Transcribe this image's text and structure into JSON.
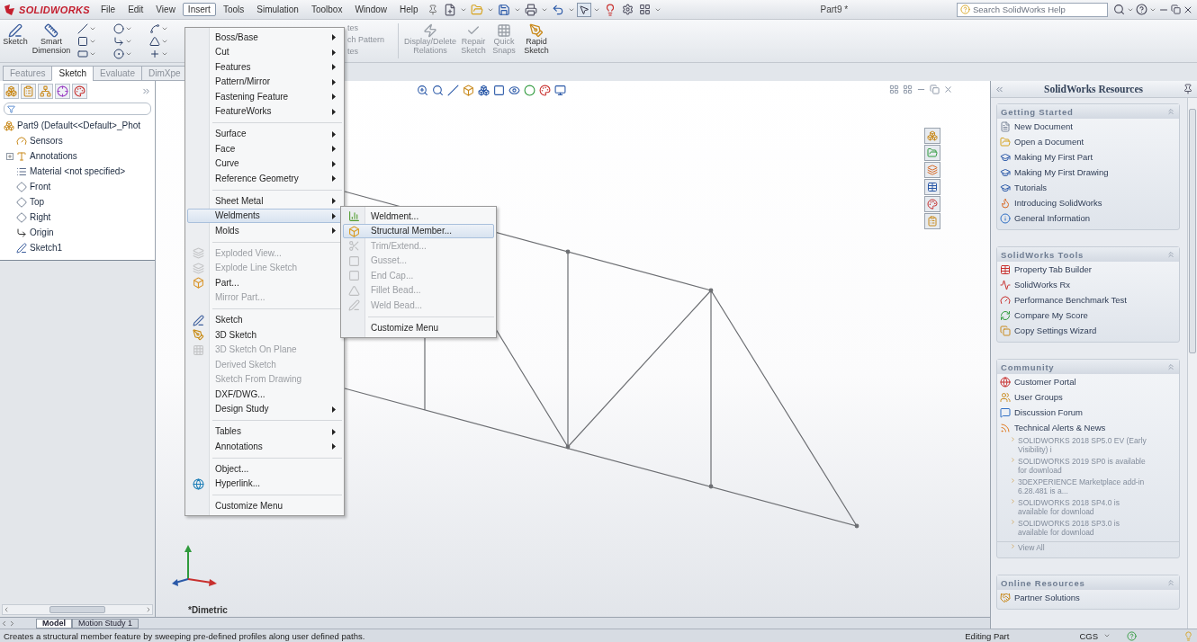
{
  "app": {
    "logo": "SOLIDWORKS",
    "document_title": "Part9 *"
  },
  "menu_bar": [
    {
      "label": "File",
      "selected": false
    },
    {
      "label": "Edit",
      "selected": false
    },
    {
      "label": "View",
      "selected": false
    },
    {
      "label": "Insert",
      "selected": true
    },
    {
      "label": "Tools",
      "selected": false
    },
    {
      "label": "Simulation",
      "selected": false
    },
    {
      "label": "Toolbox",
      "selected": false
    },
    {
      "label": "Window",
      "selected": false
    },
    {
      "label": "Help",
      "selected": false
    }
  ],
  "help_search": {
    "placeholder": "Search SolidWorks Help"
  },
  "ribbon": {
    "left": [
      {
        "label": "Sketch",
        "disabled": false
      },
      {
        "label": "Smart Dimension",
        "disabled": false
      }
    ],
    "partial_labels": [
      "tes",
      "ch Pattern",
      "tes"
    ],
    "right": [
      {
        "label": "Display/Delete Relations",
        "disabled": true
      },
      {
        "label": "Repair Sketch",
        "disabled": true
      },
      {
        "label": "Quick Snaps",
        "disabled": true
      },
      {
        "label": "Rapid Sketch",
        "disabled": false
      }
    ]
  },
  "command_tabs": [
    {
      "label": "Features",
      "selected": false
    },
    {
      "label": "Sketch",
      "selected": true
    },
    {
      "label": "Evaluate",
      "selected": false
    },
    {
      "label": "DimXpe",
      "selected": false
    }
  ],
  "feature_tree": {
    "label": "Part9  (Default<<Default>_Phot",
    "children": [
      {
        "label": "Sensors"
      },
      {
        "label": "Annotations",
        "expanded": false
      },
      {
        "label": "Material <not specified>"
      },
      {
        "label": "Front"
      },
      {
        "label": "Top"
      },
      {
        "label": "Right"
      },
      {
        "label": "Origin"
      },
      {
        "label": "Sketch1"
      }
    ]
  },
  "insert_menu": [
    {
      "kind": "item",
      "label": "Boss/Base",
      "submenu": true,
      "disabled": false,
      "selected": false
    },
    {
      "kind": "item",
      "label": "Cut",
      "submenu": true,
      "disabled": false,
      "selected": false
    },
    {
      "kind": "item",
      "label": "Features",
      "submenu": true,
      "disabled": false,
      "selected": false
    },
    {
      "kind": "item",
      "label": "Pattern/Mirror",
      "submenu": true,
      "disabled": false,
      "selected": false
    },
    {
      "kind": "item",
      "label": "Fastening Feature",
      "submenu": true,
      "disabled": false,
      "selected": false
    },
    {
      "kind": "item",
      "label": "FeatureWorks",
      "submenu": true,
      "disabled": false,
      "selected": false
    },
    {
      "kind": "separator"
    },
    {
      "kind": "item",
      "label": "Surface",
      "submenu": true,
      "disabled": false,
      "selected": false
    },
    {
      "kind": "item",
      "label": "Face",
      "submenu": true,
      "disabled": false,
      "selected": false
    },
    {
      "kind": "item",
      "label": "Curve",
      "submenu": true,
      "disabled": false,
      "selected": false
    },
    {
      "kind": "item",
      "label": "Reference Geometry",
      "submenu": true,
      "disabled": false,
      "selected": false
    },
    {
      "kind": "separator"
    },
    {
      "kind": "item",
      "label": "Sheet Metal",
      "submenu": true,
      "disabled": false,
      "selected": false
    },
    {
      "kind": "item",
      "label": "Weldments",
      "submenu": true,
      "disabled": false,
      "selected": true
    },
    {
      "kind": "item",
      "label": "Molds",
      "submenu": true,
      "disabled": false,
      "selected": false
    },
    {
      "kind": "separator"
    },
    {
      "kind": "item",
      "label": "Exploded View...",
      "submenu": false,
      "disabled": true,
      "selected": false
    },
    {
      "kind": "item",
      "label": "Explode Line Sketch",
      "submenu": false,
      "disabled": true,
      "selected": false
    },
    {
      "kind": "item",
      "label": "Part...",
      "submenu": false,
      "disabled": false,
      "selected": false
    },
    {
      "kind": "item",
      "label": "Mirror Part...",
      "submenu": false,
      "disabled": true,
      "selected": false
    },
    {
      "kind": "separator"
    },
    {
      "kind": "item",
      "label": "Sketch",
      "submenu": false,
      "disabled": false,
      "selected": false
    },
    {
      "kind": "item",
      "label": "3D Sketch",
      "submenu": false,
      "disabled": false,
      "selected": false
    },
    {
      "kind": "item",
      "label": "3D Sketch On Plane",
      "submenu": false,
      "disabled": true,
      "selected": false
    },
    {
      "kind": "item",
      "label": "Derived Sketch",
      "submenu": false,
      "disabled": true,
      "selected": false
    },
    {
      "kind": "item",
      "label": "Sketch From Drawing",
      "submenu": false,
      "disabled": true,
      "selected": false
    },
    {
      "kind": "item",
      "label": "DXF/DWG...",
      "submenu": false,
      "disabled": false,
      "selected": false
    },
    {
      "kind": "item",
      "label": "Design Study",
      "submenu": true,
      "disabled": false,
      "selected": false
    },
    {
      "kind": "separator"
    },
    {
      "kind": "item",
      "label": "Tables",
      "submenu": true,
      "disabled": false,
      "selected": false
    },
    {
      "kind": "item",
      "label": "Annotations",
      "submenu": true,
      "disabled": false,
      "selected": false
    },
    {
      "kind": "separator"
    },
    {
      "kind": "item",
      "label": "Object...",
      "submenu": false,
      "disabled": false,
      "selected": false
    },
    {
      "kind": "item",
      "label": "Hyperlink...",
      "submenu": false,
      "disabled": false,
      "selected": false
    },
    {
      "kind": "separator"
    },
    {
      "kind": "item",
      "label": "Customize Menu",
      "submenu": false,
      "disabled": false,
      "selected": false
    }
  ],
  "weldments_submenu": [
    {
      "kind": "item",
      "label": "Weldment...",
      "submenu": false,
      "disabled": false,
      "selected": false
    },
    {
      "kind": "item",
      "label": "Structural Member...",
      "submenu": false,
      "disabled": false,
      "selected": true
    },
    {
      "kind": "item",
      "label": "Trim/Extend...",
      "submenu": false,
      "disabled": true,
      "selected": false
    },
    {
      "kind": "item",
      "label": "Gusset...",
      "submenu": false,
      "disabled": true,
      "selected": false
    },
    {
      "kind": "item",
      "label": "End Cap...",
      "submenu": false,
      "disabled": true,
      "selected": false
    },
    {
      "kind": "item",
      "label": "Fillet Bead...",
      "submenu": false,
      "disabled": true,
      "selected": false
    },
    {
      "kind": "item",
      "label": "Weld Bead...",
      "submenu": false,
      "disabled": true,
      "selected": false
    },
    {
      "kind": "separator"
    },
    {
      "kind": "item",
      "label": "Customize Menu",
      "submenu": false,
      "disabled": false,
      "selected": false
    }
  ],
  "view": {
    "orientation_label": "*Dimetric"
  },
  "resources": {
    "title": "SolidWorks Resources",
    "sections": [
      {
        "title": "Getting Started",
        "expanded": true,
        "items": [
          {
            "kind": "link",
            "label": "New Document"
          },
          {
            "kind": "link",
            "label": "Open a Document"
          },
          {
            "kind": "link",
            "label": "Making My First Part"
          },
          {
            "kind": "link",
            "label": "Making My First Drawing"
          },
          {
            "kind": "link",
            "label": "Tutorials"
          },
          {
            "kind": "link",
            "label": "Introducing SolidWorks"
          },
          {
            "kind": "link",
            "label": "General Information"
          }
        ]
      },
      {
        "title": "SolidWorks Tools",
        "expanded": true,
        "items": [
          {
            "kind": "link",
            "label": "Property Tab Builder"
          },
          {
            "kind": "link",
            "label": "SolidWorks Rx"
          },
          {
            "kind": "link",
            "label": "Performance Benchmark Test"
          },
          {
            "kind": "link",
            "label": "Compare My Score"
          },
          {
            "kind": "link",
            "label": "Copy Settings Wizard"
          }
        ]
      },
      {
        "title": "Community",
        "expanded": true,
        "items": [
          {
            "kind": "link",
            "label": "Customer Portal"
          },
          {
            "kind": "link",
            "label": "User Groups"
          },
          {
            "kind": "link",
            "label": "Discussion Forum"
          },
          {
            "kind": "link",
            "label": "Technical Alerts & News"
          },
          {
            "kind": "news",
            "label": "SOLIDWORKS 2018 SP5.0 EV (Early Visibility) i"
          },
          {
            "kind": "news",
            "label": "SOLIDWORKS 2019 SP0 is available for download"
          },
          {
            "kind": "news",
            "label": "3DEXPERIENCE Marketplace add-in 6.28.481 is a..."
          },
          {
            "kind": "news",
            "label": "SOLIDWORKS 2018 SP4.0 is available for download"
          },
          {
            "kind": "news",
            "label": "SOLIDWORKS 2018 SP3.0 is available for download"
          },
          {
            "kind": "more",
            "label": "View All"
          }
        ]
      },
      {
        "title": "Online Resources",
        "expanded": true,
        "items": [
          {
            "kind": "link",
            "label": "Partner Solutions"
          }
        ]
      }
    ]
  },
  "bottom_tabs": [
    {
      "label": "Model",
      "selected": true
    },
    {
      "label": "Motion Study 1",
      "selected": false
    }
  ],
  "status_bar": {
    "message": "Creates a structural member feature by sweeping pre-defined profiles along user defined paths.",
    "mode": "Editing Part",
    "units": "CGS"
  }
}
